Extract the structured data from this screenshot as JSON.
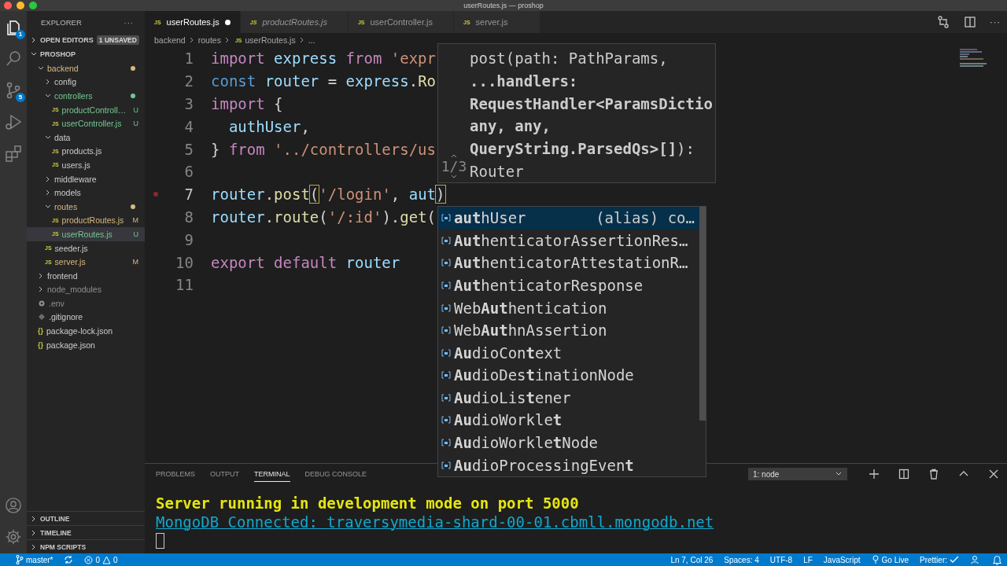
{
  "window": {
    "title": "userRoutes.js — proshop"
  },
  "activity_bar": {
    "top": [
      {
        "kind": "files",
        "badge": "1",
        "selected": true
      },
      {
        "kind": "search",
        "selected": false
      },
      {
        "kind": "source-control",
        "badge": "5",
        "selected": false
      },
      {
        "kind": "run",
        "selected": false
      },
      {
        "kind": "extensions",
        "selected": false
      }
    ],
    "bottom": [
      {
        "kind": "account"
      },
      {
        "kind": "settings"
      }
    ]
  },
  "sidebar": {
    "title": "EXPLORER",
    "more": "···",
    "open_editors": {
      "label": "OPEN EDITORS",
      "badge": "1 UNSAVED"
    },
    "root": "PROSHOP",
    "items": [
      {
        "name": "backend",
        "kind": "folder",
        "expanded": true,
        "modified": true,
        "untracked": false,
        "ignored": false,
        "dot": true,
        "selected": false,
        "children": [
          {
            "name": "config",
            "kind": "folder",
            "expanded": false,
            "modified": false,
            "untracked": false,
            "ignored": false,
            "selected": false
          },
          {
            "name": "controllers",
            "kind": "folder",
            "expanded": true,
            "modified": false,
            "untracked": true,
            "ignored": false,
            "dot": true,
            "selected": false,
            "children": [
              {
                "name": "productControll…",
                "kind": "js",
                "icon": "JS",
                "modified": false,
                "untracked": true,
                "ignored": false,
                "badge": "U",
                "selected": false
              },
              {
                "name": "userController.js",
                "kind": "js",
                "icon": "JS",
                "modified": false,
                "untracked": true,
                "ignored": false,
                "badge": "U",
                "selected": false
              }
            ]
          },
          {
            "name": "data",
            "kind": "folder",
            "expanded": true,
            "modified": false,
            "untracked": false,
            "ignored": false,
            "selected": false,
            "children": [
              {
                "name": "products.js",
                "kind": "js",
                "icon": "JS",
                "modified": false,
                "untracked": false,
                "ignored": false,
                "selected": false
              },
              {
                "name": "users.js",
                "kind": "js",
                "icon": "JS",
                "modified": false,
                "untracked": false,
                "ignored": false,
                "selected": false
              }
            ]
          },
          {
            "name": "middleware",
            "kind": "folder",
            "expanded": false,
            "modified": false,
            "untracked": false,
            "ignored": false,
            "selected": false
          },
          {
            "name": "models",
            "kind": "folder",
            "expanded": false,
            "modified": false,
            "untracked": false,
            "ignored": false,
            "selected": false
          },
          {
            "name": "routes",
            "kind": "folder",
            "expanded": true,
            "modified": true,
            "untracked": false,
            "ignored": false,
            "dot": true,
            "selected": false,
            "children": [
              {
                "name": "productRoutes.js",
                "kind": "js",
                "icon": "JS",
                "modified": true,
                "untracked": false,
                "ignored": false,
                "badge": "M",
                "selected": false
              },
              {
                "name": "userRoutes.js",
                "kind": "js",
                "icon": "JS",
                "modified": false,
                "untracked": true,
                "ignored": false,
                "badge": "U",
                "selected": true
              }
            ]
          },
          {
            "name": "seeder.js",
            "kind": "js",
            "icon": "JS",
            "modified": false,
            "untracked": false,
            "ignored": false,
            "selected": false
          },
          {
            "name": "server.js",
            "kind": "js",
            "icon": "JS",
            "modified": true,
            "untracked": false,
            "ignored": false,
            "badge": "M",
            "selected": false
          }
        ]
      },
      {
        "name": "frontend",
        "kind": "folder",
        "expanded": false,
        "modified": false,
        "untracked": false,
        "ignored": false,
        "selected": false
      },
      {
        "name": "node_modules",
        "kind": "folder",
        "expanded": false,
        "modified": false,
        "untracked": false,
        "ignored": true,
        "selected": false
      },
      {
        "name": ".env",
        "kind": "env",
        "modified": false,
        "untracked": false,
        "ignored": true,
        "selected": false
      },
      {
        "name": ".gitignore",
        "kind": "gitignore",
        "modified": false,
        "untracked": false,
        "ignored": false,
        "selected": false
      },
      {
        "name": "package-lock.json",
        "kind": "json",
        "icon": "{}",
        "modified": false,
        "untracked": false,
        "ignored": false,
        "selected": false
      },
      {
        "name": "package.json",
        "kind": "json",
        "icon": "{}",
        "modified": false,
        "untracked": false,
        "ignored": false,
        "selected": false
      }
    ],
    "sections": [
      "OUTLINE",
      "TIMELINE",
      "NPM SCRIPTS"
    ]
  },
  "tabs": [
    {
      "icon": "JS",
      "label": "userRoutes.js",
      "selected": true,
      "dirty": true,
      "preview": false
    },
    {
      "icon": "JS",
      "label": "productRoutes.js",
      "selected": false,
      "dirty": false,
      "preview": true
    },
    {
      "icon": "JS",
      "label": "userController.js",
      "selected": false,
      "dirty": false,
      "preview": false
    },
    {
      "icon": "JS",
      "label": "server.js",
      "selected": false,
      "dirty": false,
      "preview": false
    }
  ],
  "editor_actions_more": "···",
  "breadcrumb": [
    {
      "label": "backend"
    },
    {
      "label": "routes"
    },
    {
      "icon": "JS",
      "label": "userRoutes.js"
    },
    {
      "label": "..."
    }
  ],
  "code": [
    {
      "number": "1",
      "tokens": [
        {
          "kind": "kw",
          "text": "import"
        },
        {
          "kind": "var",
          "text": " express "
        },
        {
          "kind": "kw",
          "text": "from"
        },
        {
          "kind": "str",
          "text": " 'expr"
        }
      ]
    },
    {
      "number": "2",
      "tokens": [
        {
          "kind": "decl",
          "text": "const"
        },
        {
          "kind": "var",
          "text": " router "
        },
        {
          "kind": "punct",
          "text": "= "
        },
        {
          "kind": "var",
          "text": "express"
        },
        {
          "kind": "punct",
          "text": "."
        },
        {
          "kind": "fn",
          "text": "Ro"
        }
      ]
    },
    {
      "number": "3",
      "tokens": [
        {
          "kind": "kw",
          "text": "import"
        },
        {
          "kind": "punct",
          "text": " {"
        }
      ]
    },
    {
      "number": "4",
      "tokens": [
        {
          "kind": "var",
          "text": "  authUser"
        },
        {
          "kind": "punct",
          "text": ","
        }
      ]
    },
    {
      "number": "5",
      "tokens": [
        {
          "kind": "punct",
          "text": "} "
        },
        {
          "kind": "kw",
          "text": "from"
        },
        {
          "kind": "str",
          "text": " '../controllers/us"
        }
      ]
    },
    {
      "number": "6"
    },
    {
      "number": "7",
      "breakpoint": true,
      "tokens": [
        {
          "kind": "var",
          "text": "router"
        },
        {
          "kind": "punct",
          "text": "."
        },
        {
          "kind": "fn",
          "text": "post"
        },
        {
          "kind": "match",
          "text": "("
        },
        {
          "kind": "str",
          "text": "'/login'"
        },
        {
          "kind": "punct",
          "text": ", "
        },
        {
          "kind": "var",
          "text": "aut"
        },
        {
          "kind": "match",
          "text": ")"
        }
      ]
    },
    {
      "number": "8",
      "tokens": [
        {
          "kind": "var",
          "text": "router"
        },
        {
          "kind": "punct",
          "text": "."
        },
        {
          "kind": "fn",
          "text": "route"
        },
        {
          "kind": "punct",
          "text": "("
        },
        {
          "kind": "str",
          "text": "'/:id'"
        },
        {
          "kind": "punct",
          "text": ")."
        },
        {
          "kind": "fn",
          "text": "get"
        },
        {
          "kind": "punct",
          "text": "("
        }
      ]
    },
    {
      "number": "9"
    },
    {
      "number": "10",
      "tokens": [
        {
          "kind": "kw",
          "text": "export default"
        },
        {
          "kind": "var",
          "text": " router"
        }
      ]
    },
    {
      "number": "11"
    }
  ],
  "hover": {
    "counter": "1/3",
    "lines": [
      "post(path: PathParams,",
      "**...handlers:**",
      "**RequestHandler<ParamsDictio**",
      "**any, any,**",
      "**QueryString.ParsedQs>[]**):",
      "Router"
    ]
  },
  "suggestions": [
    {
      "label": "**aut**hUser",
      "detail": "(alias) co…",
      "selected": true
    },
    {
      "label": "**Aut**henticatorAssertionRes…",
      "selected": false
    },
    {
      "label": "**Aut**henticatorAttestationR…",
      "selected": false
    },
    {
      "label": "**Aut**henticatorResponse",
      "selected": false
    },
    {
      "label": "Web**Aut**hentication",
      "selected": false
    },
    {
      "label": "Web**Aut**hnAssertion",
      "selected": false
    },
    {
      "label": "**Au**dioCon**t**ext",
      "selected": false
    },
    {
      "label": "**Au**dioDes**t**inationNode",
      "selected": false
    },
    {
      "label": "**Au**dioLis**t**ener",
      "selected": false
    },
    {
      "label": "**Au**dioWorkle**t**",
      "selected": false
    },
    {
      "label": "**Au**dioWorkle**t**Node",
      "selected": false
    },
    {
      "label": "**Au**dioProcessingEven**t**",
      "selected": false
    }
  ],
  "panel": {
    "tabs": [
      {
        "label": "PROBLEMS",
        "selected": false
      },
      {
        "label": "OUTPUT",
        "selected": false
      },
      {
        "label": "TERMINAL",
        "selected": true
      },
      {
        "label": "DEBUG CONSOLE",
        "selected": false
      }
    ],
    "terminal_select": "1: node",
    "terminal": [
      {
        "kind": "success",
        "text": "Server running in development mode on port 5000"
      },
      {
        "kind": "info",
        "text": "MongoDB Connected: traversymedia-shard-00-01.cbmll.mongodb.net"
      }
    ]
  },
  "status_bar": {
    "branch": "master*",
    "errors": "0",
    "warnings": "0",
    "items": [
      "Ln 7, Col 26",
      "Spaces: 4",
      "UTF-8",
      "LF",
      "JavaScript"
    ],
    "go_live": "Go Live",
    "prettier": "Prettier:"
  }
}
